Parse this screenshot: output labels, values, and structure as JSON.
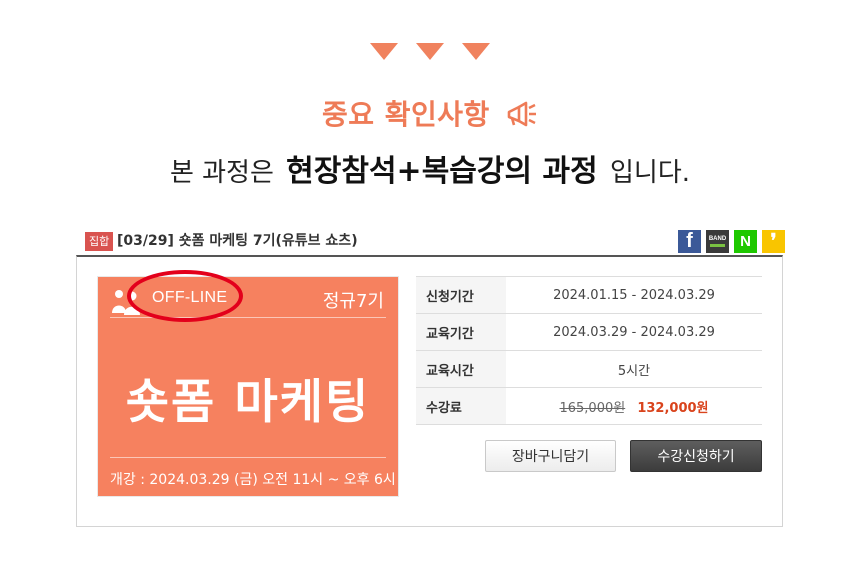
{
  "notice": {
    "title": "중요 확인사항",
    "sub_prefix": "본 과정은",
    "sub_bold": "현장참석+복습강의 과정",
    "sub_suffix": "입니다."
  },
  "course": {
    "badge": "집합",
    "title": "[03/29] 숏폼 마케팅 7기(유튜브 쇼츠)",
    "share": {
      "facebook": "f",
      "band": "BAND",
      "naver": "N",
      "kakao": "❜"
    }
  },
  "poster": {
    "mode": "OFF-LINE",
    "cohort": "정규7기",
    "main_title": "숏폼 마케팅",
    "schedule": "개강 : 2024.03.29 (금) 오전 11시 ~ 오후 6시"
  },
  "info": [
    {
      "label": "신청기간",
      "value": "2024.01.15 - 2024.03.29"
    },
    {
      "label": "교육기간",
      "value": "2024.03.29 - 2024.03.29"
    },
    {
      "label": "교육시간",
      "value": "5시간"
    }
  ],
  "price": {
    "label": "수강료",
    "original": "165,000원",
    "sale": "132,000원"
  },
  "buttons": {
    "cart": "장바구니담기",
    "apply": "수강신청하기"
  },
  "colors": {
    "accent": "#ee7b57",
    "poster_bg": "#f6815f",
    "highlight_circle": "#e3001b",
    "sale_price": "#d9431c"
  }
}
